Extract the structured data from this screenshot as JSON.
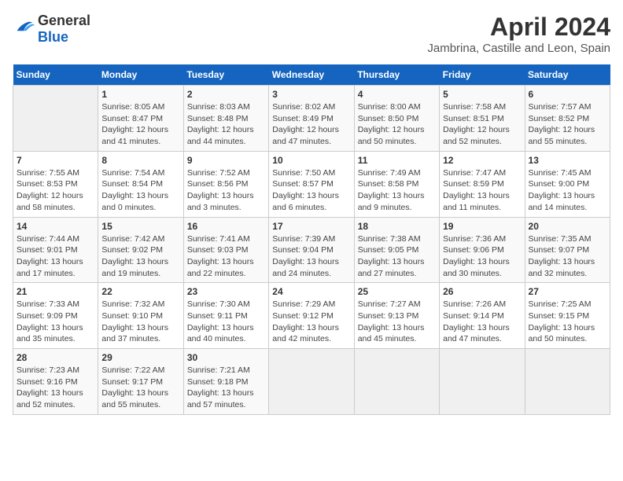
{
  "logo": {
    "general": "General",
    "blue": "Blue"
  },
  "title": "April 2024",
  "subtitle": "Jambrina, Castille and Leon, Spain",
  "header_days": [
    "Sunday",
    "Monday",
    "Tuesday",
    "Wednesday",
    "Thursday",
    "Friday",
    "Saturday"
  ],
  "weeks": [
    [
      {
        "day": "",
        "info": ""
      },
      {
        "day": "1",
        "info": "Sunrise: 8:05 AM\nSunset: 8:47 PM\nDaylight: 12 hours\nand 41 minutes."
      },
      {
        "day": "2",
        "info": "Sunrise: 8:03 AM\nSunset: 8:48 PM\nDaylight: 12 hours\nand 44 minutes."
      },
      {
        "day": "3",
        "info": "Sunrise: 8:02 AM\nSunset: 8:49 PM\nDaylight: 12 hours\nand 47 minutes."
      },
      {
        "day": "4",
        "info": "Sunrise: 8:00 AM\nSunset: 8:50 PM\nDaylight: 12 hours\nand 50 minutes."
      },
      {
        "day": "5",
        "info": "Sunrise: 7:58 AM\nSunset: 8:51 PM\nDaylight: 12 hours\nand 52 minutes."
      },
      {
        "day": "6",
        "info": "Sunrise: 7:57 AM\nSunset: 8:52 PM\nDaylight: 12 hours\nand 55 minutes."
      }
    ],
    [
      {
        "day": "7",
        "info": "Sunrise: 7:55 AM\nSunset: 8:53 PM\nDaylight: 12 hours\nand 58 minutes."
      },
      {
        "day": "8",
        "info": "Sunrise: 7:54 AM\nSunset: 8:54 PM\nDaylight: 13 hours\nand 0 minutes."
      },
      {
        "day": "9",
        "info": "Sunrise: 7:52 AM\nSunset: 8:56 PM\nDaylight: 13 hours\nand 3 minutes."
      },
      {
        "day": "10",
        "info": "Sunrise: 7:50 AM\nSunset: 8:57 PM\nDaylight: 13 hours\nand 6 minutes."
      },
      {
        "day": "11",
        "info": "Sunrise: 7:49 AM\nSunset: 8:58 PM\nDaylight: 13 hours\nand 9 minutes."
      },
      {
        "day": "12",
        "info": "Sunrise: 7:47 AM\nSunset: 8:59 PM\nDaylight: 13 hours\nand 11 minutes."
      },
      {
        "day": "13",
        "info": "Sunrise: 7:45 AM\nSunset: 9:00 PM\nDaylight: 13 hours\nand 14 minutes."
      }
    ],
    [
      {
        "day": "14",
        "info": "Sunrise: 7:44 AM\nSunset: 9:01 PM\nDaylight: 13 hours\nand 17 minutes."
      },
      {
        "day": "15",
        "info": "Sunrise: 7:42 AM\nSunset: 9:02 PM\nDaylight: 13 hours\nand 19 minutes."
      },
      {
        "day": "16",
        "info": "Sunrise: 7:41 AM\nSunset: 9:03 PM\nDaylight: 13 hours\nand 22 minutes."
      },
      {
        "day": "17",
        "info": "Sunrise: 7:39 AM\nSunset: 9:04 PM\nDaylight: 13 hours\nand 24 minutes."
      },
      {
        "day": "18",
        "info": "Sunrise: 7:38 AM\nSunset: 9:05 PM\nDaylight: 13 hours\nand 27 minutes."
      },
      {
        "day": "19",
        "info": "Sunrise: 7:36 AM\nSunset: 9:06 PM\nDaylight: 13 hours\nand 30 minutes."
      },
      {
        "day": "20",
        "info": "Sunrise: 7:35 AM\nSunset: 9:07 PM\nDaylight: 13 hours\nand 32 minutes."
      }
    ],
    [
      {
        "day": "21",
        "info": "Sunrise: 7:33 AM\nSunset: 9:09 PM\nDaylight: 13 hours\nand 35 minutes."
      },
      {
        "day": "22",
        "info": "Sunrise: 7:32 AM\nSunset: 9:10 PM\nDaylight: 13 hours\nand 37 minutes."
      },
      {
        "day": "23",
        "info": "Sunrise: 7:30 AM\nSunset: 9:11 PM\nDaylight: 13 hours\nand 40 minutes."
      },
      {
        "day": "24",
        "info": "Sunrise: 7:29 AM\nSunset: 9:12 PM\nDaylight: 13 hours\nand 42 minutes."
      },
      {
        "day": "25",
        "info": "Sunrise: 7:27 AM\nSunset: 9:13 PM\nDaylight: 13 hours\nand 45 minutes."
      },
      {
        "day": "26",
        "info": "Sunrise: 7:26 AM\nSunset: 9:14 PM\nDaylight: 13 hours\nand 47 minutes."
      },
      {
        "day": "27",
        "info": "Sunrise: 7:25 AM\nSunset: 9:15 PM\nDaylight: 13 hours\nand 50 minutes."
      }
    ],
    [
      {
        "day": "28",
        "info": "Sunrise: 7:23 AM\nSunset: 9:16 PM\nDaylight: 13 hours\nand 52 minutes."
      },
      {
        "day": "29",
        "info": "Sunrise: 7:22 AM\nSunset: 9:17 PM\nDaylight: 13 hours\nand 55 minutes."
      },
      {
        "day": "30",
        "info": "Sunrise: 7:21 AM\nSunset: 9:18 PM\nDaylight: 13 hours\nand 57 minutes."
      },
      {
        "day": "",
        "info": ""
      },
      {
        "day": "",
        "info": ""
      },
      {
        "day": "",
        "info": ""
      },
      {
        "day": "",
        "info": ""
      }
    ]
  ]
}
